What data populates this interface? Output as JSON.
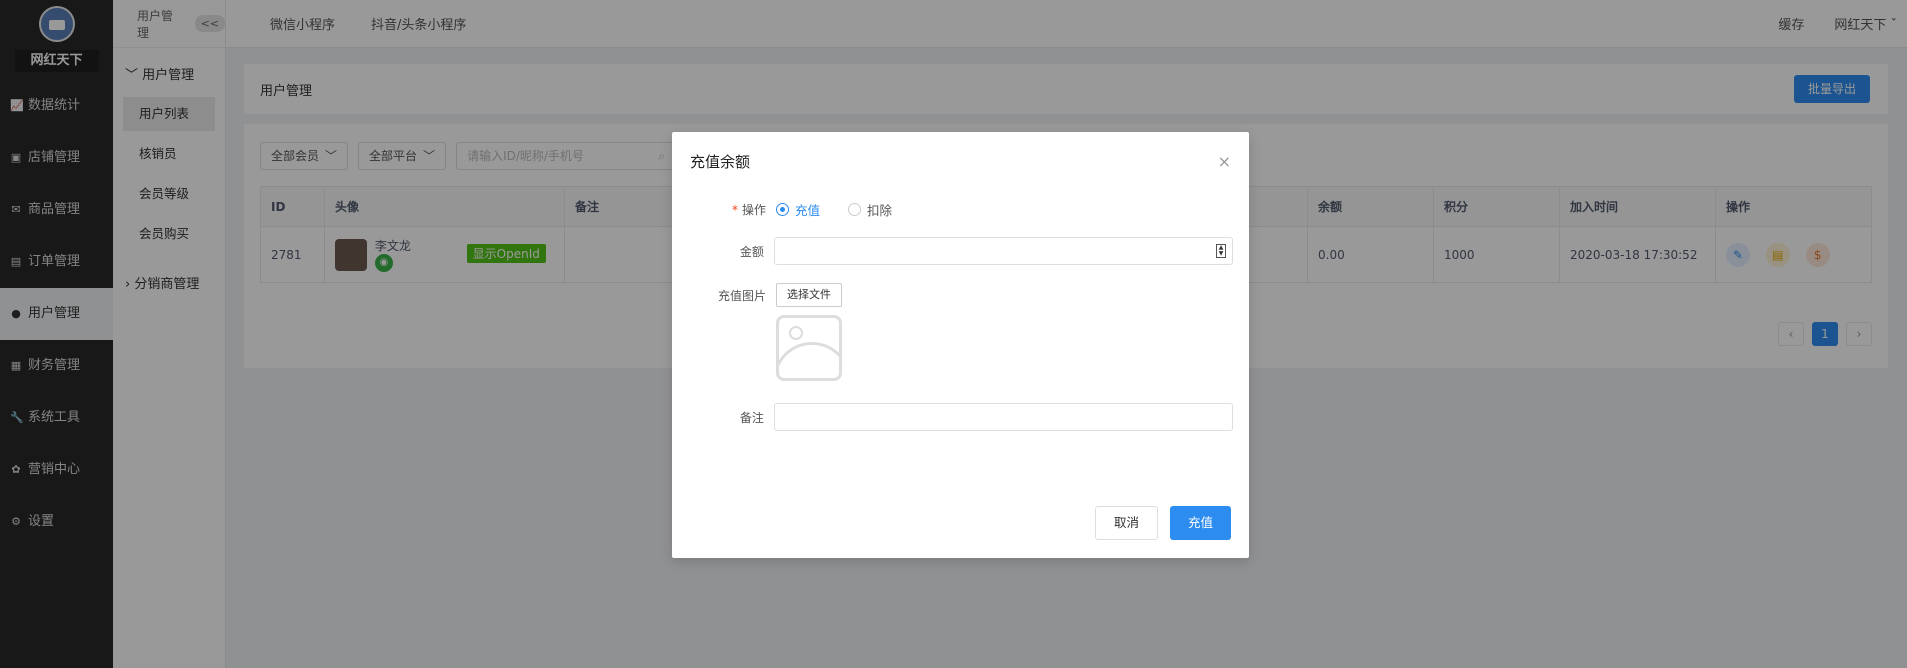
{
  "brand": "网红天下",
  "nav": [
    {
      "label": "数据统计",
      "icon": "chart-icon"
    },
    {
      "label": "店铺管理",
      "icon": "shop-icon"
    },
    {
      "label": "商品管理",
      "icon": "goods-icon"
    },
    {
      "label": "订单管理",
      "icon": "order-icon"
    },
    {
      "label": "用户管理",
      "icon": "user-icon",
      "active": true
    },
    {
      "label": "财务管理",
      "icon": "finance-icon"
    },
    {
      "label": "系统工具",
      "icon": "wrench-icon"
    },
    {
      "label": "营销中心",
      "icon": "marketing-icon"
    },
    {
      "label": "设置",
      "icon": "gear-icon"
    }
  ],
  "subside": {
    "header": "用户管理",
    "collapse": "<<",
    "group": "用户管理",
    "items": [
      "用户列表",
      "核销员",
      "会员等级",
      "会员购买"
    ],
    "group2": "分销商管理"
  },
  "topbar": {
    "tabs": [
      "微信小程序",
      "抖音/头条小程序"
    ],
    "cache": "缓存",
    "user": "网红天下"
  },
  "panel": {
    "title": "用户管理",
    "export": "批量导出"
  },
  "filters": {
    "member": "全部会员",
    "platform": "全部平台",
    "search_placeholder": "请输入ID/昵称/手机号"
  },
  "table": {
    "headers": [
      "ID",
      "头像",
      "备注",
      "余额",
      "积分",
      "加入时间",
      "操作"
    ],
    "row": {
      "id": "2781",
      "name": "李文龙",
      "openid": "显示OpenId",
      "balance": "0.00",
      "points": "1000",
      "joined": "2020-03-18 17:30:52"
    }
  },
  "pager": {
    "prev": "‹",
    "page": "1",
    "next": "›"
  },
  "modal": {
    "title": "充值余额",
    "close": "×",
    "op_label": "操作",
    "op_required": "*",
    "op_recharge": "充值",
    "op_deduct": "扣除",
    "amount_label": "金额",
    "amount_value": "",
    "image_label": "充值图片",
    "choose_file": "选择文件",
    "remark_label": "备注",
    "remark_value": "",
    "cancel": "取消",
    "confirm": "充值"
  }
}
